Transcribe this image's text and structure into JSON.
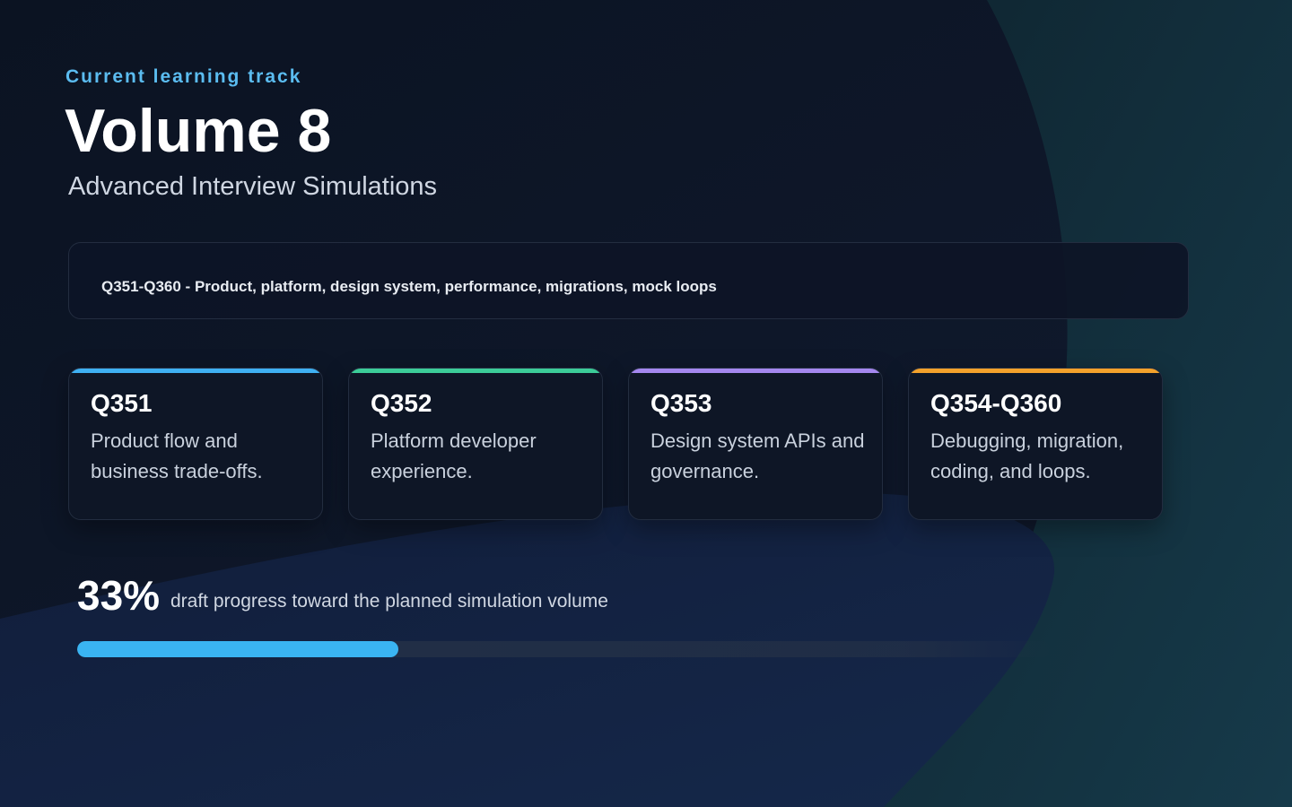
{
  "header": {
    "eyebrow": "Current learning track",
    "title": "Volume 8",
    "subtitle": "Advanced Interview Simulations"
  },
  "range": {
    "text": "Q351-Q360 - Product, platform, design system, performance, migrations, mock loops"
  },
  "topics": [
    {
      "id": "Q351",
      "description": "Product flow and business trade-offs.",
      "accent": "#3fb0f2"
    },
    {
      "id": "Q352",
      "description": "Platform developer experience.",
      "accent": "#3ccc98"
    },
    {
      "id": "Q353",
      "description": "Design system APIs and governance.",
      "accent": "#a487ee"
    },
    {
      "id": "Q354-Q360",
      "description": "Debugging, migration, coding, and loops.",
      "accent": "#f3a12b"
    }
  ],
  "progress": {
    "percent_label": "33%",
    "caption": "draft progress toward the planned simulation volume",
    "fraction": 0.33,
    "color": "#3ab4f2"
  }
}
